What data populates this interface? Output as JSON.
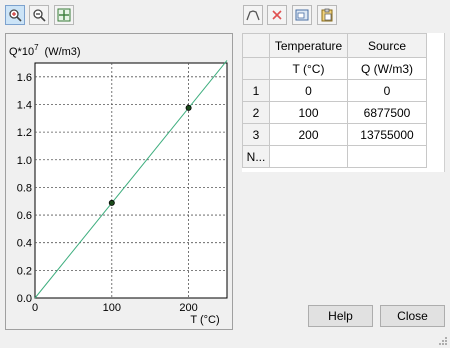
{
  "toolbar": {
    "left": [
      {
        "icon": "zoom-in-icon",
        "active": true
      },
      {
        "icon": "zoom-out-icon",
        "active": false
      },
      {
        "icon": "fit-view-icon",
        "active": false
      }
    ],
    "right": [
      {
        "icon": "fit-curve-icon"
      },
      {
        "icon": "delete-icon"
      },
      {
        "icon": "import-icon"
      },
      {
        "icon": "paste-icon"
      }
    ]
  },
  "chart_data": {
    "type": "line",
    "ylabel_prefix": "Q*10",
    "ylabel_exp": "7",
    "ylabel_unit": "(W/m3)",
    "xlabel": "T (°C)",
    "xlim": [
      0,
      250
    ],
    "ylim": [
      0,
      1.7
    ],
    "x_ticks": [
      "0",
      "100",
      "200"
    ],
    "y_ticks": [
      "0.0",
      "0.2",
      "0.4",
      "0.6",
      "0.8",
      "1.0",
      "1.2",
      "1.4",
      "1.6"
    ],
    "grid": true,
    "line": {
      "x": [
        0,
        250
      ],
      "y": [
        0,
        1.71875
      ],
      "color": "#3fae7f"
    },
    "points": {
      "x": [
        100,
        200
      ],
      "y": [
        0.68775,
        1.3755
      ]
    }
  },
  "table": {
    "headers": [
      "Temperature",
      "Source"
    ],
    "subheaders": [
      "T (°C)",
      "Q (W/m3)"
    ],
    "rows": [
      {
        "id": "1",
        "t": "0",
        "q": "0"
      },
      {
        "id": "2",
        "t": "100",
        "q": "6877500"
      },
      {
        "id": "3",
        "t": "200",
        "q": "13755000"
      }
    ],
    "new_row_label": "N..."
  },
  "buttons": {
    "help": "Help",
    "close": "Close"
  }
}
